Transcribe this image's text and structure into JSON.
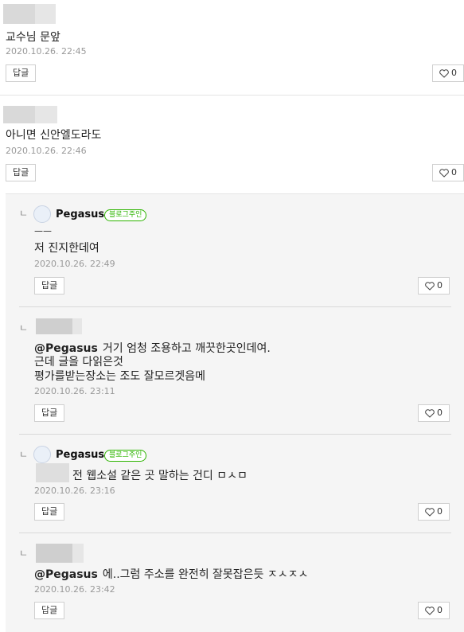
{
  "comments": [
    {
      "text": "교수님 문앞",
      "date": "2020.10.26. 22:45",
      "reply_label": "답글",
      "likes": "0"
    },
    {
      "text": "아니면 신안엘도라도",
      "date": "2020.10.26. 22:46",
      "reply_label": "답글",
      "likes": "0"
    }
  ],
  "replies": [
    {
      "nickname": "Pegasus",
      "badge": "블로그주인",
      "line1": "ㅡㅡ",
      "line2": "저 진지한데여",
      "date": "2020.10.26. 22:49",
      "reply_label": "답글",
      "likes": "0"
    },
    {
      "mention": "@Pegasus",
      "line1": "거기 엄청 조용하고 깨끗한곳인데여.",
      "line2": "근데 글을 다읽은것",
      "line3": "평가를받는장소는 조도 잘모르겟음메",
      "date": "2020.10.26. 23:11",
      "reply_label": "답글",
      "likes": "0"
    },
    {
      "nickname": "Pegasus",
      "badge": "블로그주인",
      "line1": "전 웹소설 같은 곳 말하는 건디 ㅁㅅㅁ",
      "date": "2020.10.26. 23:16",
      "reply_label": "답글",
      "likes": "0"
    },
    {
      "mention": "@Pegasus",
      "line1": "에..그럼 주소를 완전히 잘못잡은듯 ㅈㅅㅈㅅ",
      "date": "2020.10.26. 23:42",
      "reply_label": "답글",
      "likes": "0"
    }
  ],
  "icons": {
    "reply_arrow": "ㄴ",
    "heart": "heart-icon"
  }
}
